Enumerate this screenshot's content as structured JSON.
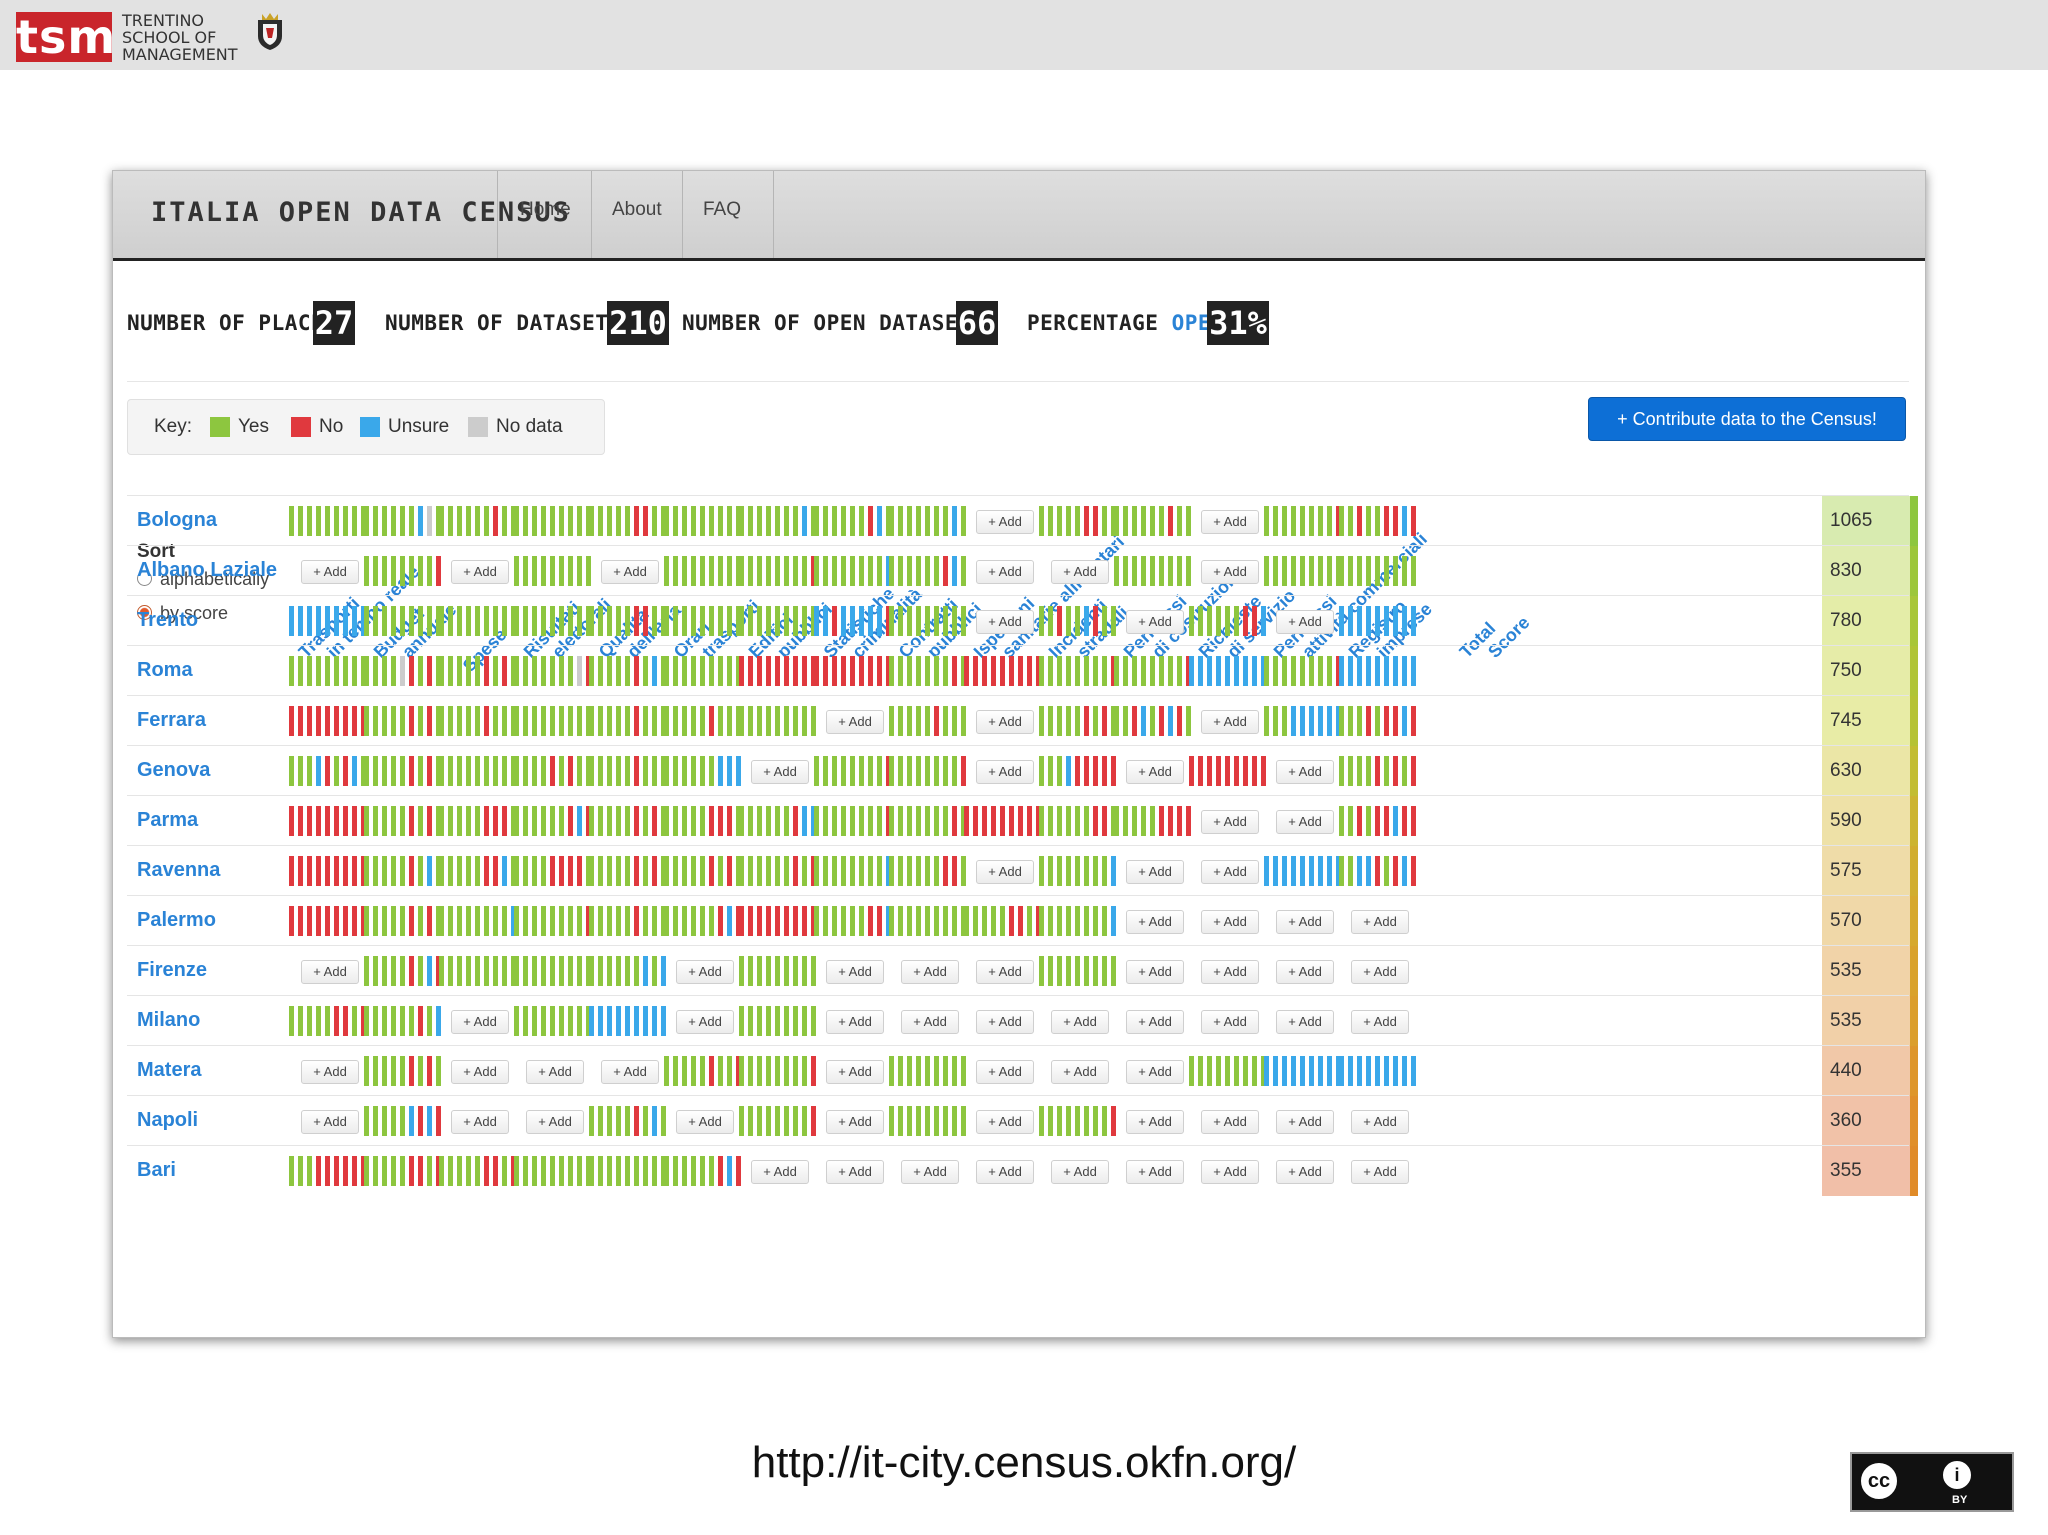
{
  "banner": {
    "logo_text": "tsm",
    "subtitle_lines": [
      "TRENTINO",
      "SCHOOL OF",
      "MANAGEMENT"
    ]
  },
  "navbar": {
    "brand": "ITALIA OPEN DATA CENSUS",
    "links": [
      "Home",
      "About",
      "FAQ"
    ]
  },
  "stats": {
    "places_label": "NUMBER OF PLACES",
    "places_value": "27",
    "datasets_label": "NUMBER OF DATASETS",
    "datasets_value": "210",
    "open_datasets_label": "NUMBER OF OPEN DATASETS",
    "open_datasets_value": "66",
    "percentage_label": "PERCENTAGE",
    "percentage_open_word": "OPEN",
    "percentage_value": "31%"
  },
  "key": {
    "label": "Key:",
    "items": [
      {
        "label": "Yes",
        "color": "#8dc63f"
      },
      {
        "label": "No",
        "color": "#e0393e"
      },
      {
        "label": "Unsure",
        "color": "#3aa8ea"
      },
      {
        "label": "No data",
        "color": "#cccccc"
      }
    ]
  },
  "contribute_button": "+ Contribute data to the Census!",
  "sort": {
    "title": "Sort",
    "options": [
      {
        "label": "alphabetically",
        "selected": false
      },
      {
        "label": "by score",
        "selected": true
      }
    ]
  },
  "columns": [
    [
      "Trasporti",
      "in tempo reale"
    ],
    [
      "Budget",
      "annuale"
    ],
    [
      "Spese",
      ""
    ],
    [
      "Risultati",
      "elettorali"
    ],
    [
      "Qualità",
      "dell'aria"
    ],
    [
      "Orari",
      "trasporti"
    ],
    [
      "Edifici",
      "pubblici"
    ],
    [
      "Statistiche",
      "criminalità"
    ],
    [
      "Contratti",
      "pubblici"
    ],
    [
      "Ispezioni",
      "sanitarie alimentari"
    ],
    [
      "Incidenti",
      "stradali"
    ],
    [
      "Permessi",
      "di costruzione"
    ],
    [
      "Richieste",
      "di servizio"
    ],
    [
      "Permessi",
      "attività commerciali"
    ],
    [
      "Registro",
      "imprese"
    ],
    [
      "Total",
      "Score"
    ]
  ],
  "add_label": "+ Add",
  "rows": [
    {
      "city": "Bologna",
      "score": "1065",
      "cells": [
        "YYYYYYYYY",
        "YYYYYYUBY",
        "YYYYYYNYY",
        "YYYYYYYYY",
        "YYYYYNNYY",
        "YYYYYYYYY",
        "YYYYYYYUY",
        "YYYYYYNUY",
        "YYYYYYYUY",
        "A",
        "YYYYYNNYY",
        "YYYYYYNYY",
        "A",
        "YYYYYYYYN",
        "YYNYYNNUN"
      ]
    },
    {
      "city": "Albano Laziale",
      "score": "830",
      "cells": [
        "A",
        "YYYYYYYYN",
        "A",
        "YYYYYYYYY",
        "A",
        "YYYYYYYYY",
        "YYYYYYYYN",
        "YYYYYYYYU",
        "YYYYYYNUY",
        "A",
        "A",
        "YYYYYYYYY",
        "A",
        "YYYYYYYYY",
        "YYYYYYYYY"
      ]
    },
    {
      "city": "Trento",
      "score": "780",
      "cells": [
        "UUUUUUUUU",
        "YYYYYYYYY",
        "YYYYYYYYY",
        "YYYYYYYYY",
        "YYYYYNNYY",
        "YYYYYYYYY",
        "YYYYYYYYY",
        "UUNUUUUUN",
        "YYYYYYYYY",
        "A",
        "YYNYYUNYY",
        "A",
        "YYYYYYNNU",
        "A",
        "UUUUUUUUU"
      ]
    },
    {
      "city": "Roma",
      "score": "750",
      "cells": [
        "YYYYYYYYY",
        "YYYYGNYNY",
        "YYYYYNYNY",
        "YYYYYYYGN",
        "YYYYYNYUY",
        "YYYYYYYYY",
        "NNNNNNNNN",
        "NNNNNNNNN",
        "YYYYYYYNY",
        "NNNNNNNNN",
        "YYYYYYYYN",
        "YYYYYYYYN",
        "UUUUUUUUU",
        "YYYYYYYYN",
        "UUUUUUUUU"
      ]
    },
    {
      "city": "Ferrara",
      "score": "745",
      "cells": [
        "NNNNNNNNN",
        "YYYYYNYNY",
        "YYYYYNYYY",
        "YYYYYYYYY",
        "YYYYYNYYY",
        "YYYYYNYYY",
        "YYYYYYYYY",
        "A",
        "YYYYYNYYY",
        "A",
        "YYYYYNYNY",
        "YYNUYNUNY",
        "A",
        "YYYUUUUUU",
        "YYYNYNNUN"
      ]
    },
    {
      "city": "Genova",
      "score": "630",
      "cells": [
        "YYYUNYNUY",
        "YYYYYNYNY",
        "YYYYYYYYY",
        "YYYYNYNYY",
        "YYYYYNYYY",
        "YYYYYYUUU",
        "A",
        "YYYYYYYYN",
        "YYYYYYYYN",
        "A",
        "YYYUNNNNN",
        "A",
        "NNNNNNNNN",
        "A",
        "YYYYNYNYN"
      ]
    },
    {
      "city": "Parma",
      "score": "590",
      "cells": [
        "NNNNNNNNN",
        "YYYYYNYNY",
        "YYYYYNNNY",
        "YYYYYYNUN",
        "YYYYYNYNY",
        "YYYYYNNNY",
        "YYYYYYNUU",
        "YYYYYYYYN",
        "YYYYYYYNY",
        "NNNNNNNNN",
        "YYYYYYNNY",
        "YYYYYNNNN",
        "A",
        "A",
        "YYNYNNUNN"
      ]
    },
    {
      "city": "Ravenna",
      "score": "575",
      "cells": [
        "NNNNNNNNN",
        "YYYYYNYUY",
        "YYYYYNNUY",
        "YYYYNNNNY",
        "YYYYYNYNY",
        "YYYYYNYNY",
        "YYYYYYNYN",
        "YYYYYYYYU",
        "YYYYYYNNY",
        "A",
        "YYYYYYYYU",
        "A",
        "A",
        "UUUUUUUUU",
        "YYUUNYNUN"
      ]
    },
    {
      "city": "Palermo",
      "score": "570",
      "cells": [
        "NNNNNNNNN",
        "YYYYYNYNY",
        "YYYYYYYYU",
        "YYYYYYYYN",
        "YYYYYNYYY",
        "YYYYYYNUN",
        "NNNNNNNNN",
        "YYYYYYNNU",
        "YYYYYYYYY",
        "YYYYYNNYN",
        "YYYYYYYYU",
        "A",
        "A",
        "A",
        "A"
      ]
    },
    {
      "city": "Firenze",
      "score": "535",
      "cells": [
        "A",
        "YYYYYNYUN",
        "YYYYYYYYY",
        "YYYYYYYYY",
        "YYYYYYUYU",
        "A",
        "YYYYYYYYY",
        "A",
        "A",
        "A",
        "YYYYYYYYY",
        "A",
        "A",
        "A",
        "A"
      ]
    },
    {
      "city": "Milano",
      "score": "535",
      "cells": [
        "YYYYYNNYN",
        "YYYYYYNYU",
        "A",
        "YYYYYYYYY",
        "UUUUUUUUU",
        "A",
        "YYYYYYYYY",
        "A",
        "A",
        "A",
        "A",
        "A",
        "A",
        "A",
        "A"
      ]
    },
    {
      "city": "Matera",
      "score": "440",
      "cells": [
        "A",
        "YYYYYNYNY",
        "A",
        "A",
        "A",
        "YYYYYNYYN",
        "YYYYYYYYN",
        "A",
        "YYYYYYYYY",
        "A",
        "A",
        "A",
        "YYYYYYYYY",
        "UUUUUUUUU",
        "UUUUUUUUU"
      ]
    },
    {
      "city": "Napoli",
      "score": "360",
      "cells": [
        "A",
        "YYYYYUNUN",
        "A",
        "A",
        "YYYYYNYUY",
        "A",
        "YYYYYYYYN",
        "A",
        "YYYYYYYYY",
        "A",
        "YYYYYYYYN",
        "A",
        "A",
        "A",
        "A"
      ]
    },
    {
      "city": "Bari",
      "score": "355",
      "cells": [
        "YYYNNNNNN",
        "YYYYYNNYN",
        "YYYYYNNYN",
        "YYYYYYYYY",
        "YYYYYYYYY",
        "YYYYYYNUN",
        "A",
        "A",
        "A",
        "A",
        "A",
        "A",
        "A",
        "A",
        "A"
      ]
    }
  ],
  "score_colors": [
    "#d8ebb0",
    "#e0ecb0",
    "#e4eda8",
    "#e6eca8",
    "#e8eca6",
    "#ebe6a6",
    "#eee1a7",
    "#efdca8",
    "#f0d8a8",
    "#f1d3a8",
    "#f1d0a8",
    "#f1c8a8",
    "#f1c2a8",
    "#f1bfa8"
  ],
  "strip_colors": [
    "#8dc63f",
    "#9cc63a",
    "#a8c638",
    "#b0c436",
    "#b5c234",
    "#c2bd32",
    "#ccb430",
    "#d1ad2e",
    "#d6a82c",
    "#d9a22b",
    "#db9e2b",
    "#de962a",
    "#e08f29",
    "#e08b28"
  ],
  "footer": {
    "url": "http://it-city.census.okfn.org/",
    "license_by": "BY"
  }
}
